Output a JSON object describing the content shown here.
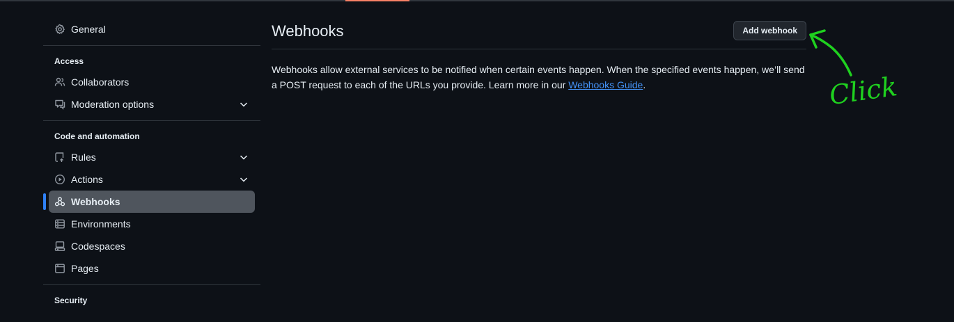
{
  "sidebar": {
    "general": {
      "label": "General",
      "icon": "gear-icon"
    },
    "groups": [
      {
        "label": "Access",
        "items": [
          {
            "label": "Collaborators",
            "icon": "people-icon",
            "expandable": false
          },
          {
            "label": "Moderation options",
            "icon": "comment-icon",
            "expandable": true
          }
        ]
      },
      {
        "label": "Code and automation",
        "items": [
          {
            "label": "Rules",
            "icon": "repo-push-icon",
            "expandable": true
          },
          {
            "label": "Actions",
            "icon": "play-icon",
            "expandable": true
          },
          {
            "label": "Webhooks",
            "icon": "webhook-icon",
            "expandable": false,
            "active": true
          },
          {
            "label": "Environments",
            "icon": "server-icon",
            "expandable": false
          },
          {
            "label": "Codespaces",
            "icon": "codespaces-icon",
            "expandable": false
          },
          {
            "label": "Pages",
            "icon": "browser-icon",
            "expandable": false
          }
        ]
      },
      {
        "label": "Security",
        "items": []
      }
    ]
  },
  "main": {
    "title": "Webhooks",
    "add_button_label": "Add webhook",
    "description_prefix": "Webhooks allow external services to be notified when certain events happen. When the specified events happen, we’ll send a POST request to each of the URLs you provide. Learn more in our ",
    "description_link": "Webhooks Guide",
    "description_suffix": "."
  },
  "annotation": {
    "text": "Click",
    "color": "#1fd11f"
  },
  "colors": {
    "background": "#0d1117",
    "accent": "#2f81f7",
    "link": "#4493f8",
    "active_tab_underline": "#f78166"
  }
}
